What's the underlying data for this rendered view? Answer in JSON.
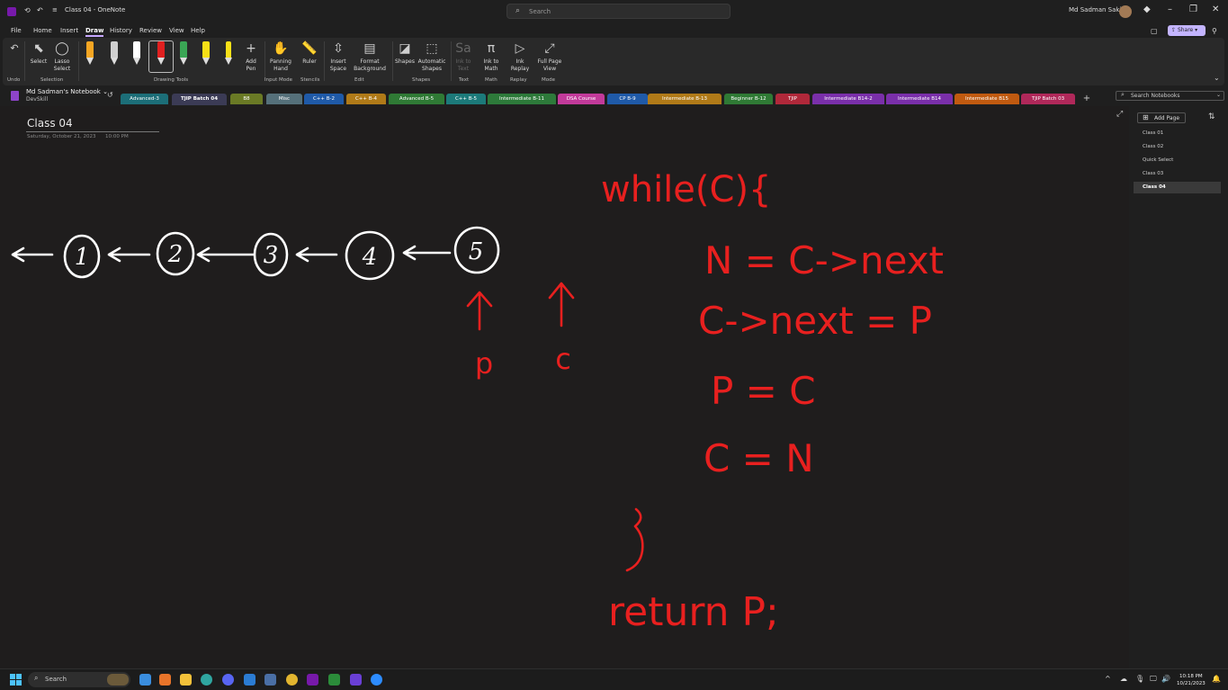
{
  "window": {
    "title": "Class 04 - OneNote",
    "search_placeholder": "Search",
    "user_name": "Md Sadman Sakib",
    "share_label": "Share"
  },
  "menu": [
    "File",
    "Home",
    "Insert",
    "Draw",
    "History",
    "Review",
    "View",
    "Help"
  ],
  "ribbon": {
    "undo": "Undo",
    "select": "Select",
    "lasso": "Lasso Select",
    "add_pen": "Add Pen",
    "panning": "Panning Hand",
    "ruler": "Ruler",
    "insert_space": "Insert Space",
    "format_bg": "Format Background",
    "shapes": "Shapes",
    "auto_shapes": "Automatic Shapes",
    "ink_to_text": "Ink to Text",
    "ink_to_math": "Ink to Math",
    "ink_replay": "Ink Replay",
    "full_page": "Full Page View",
    "groups": {
      "undo": "Undo",
      "selection": "Selection",
      "drawing_tools": "Drawing Tools",
      "input_mode": "Input Mode",
      "stencils": "Stencils",
      "edit": "Edit",
      "shapes": "Shapes",
      "text": "Text",
      "math": "Math",
      "replay": "Replay",
      "mode": "Mode"
    },
    "pen_colors": [
      "#f5a623",
      "#e0e0e0",
      "#ffffff",
      "#e02020",
      "#3aa655",
      "#f7e017",
      "#f7e017"
    ]
  },
  "notebook": {
    "name": "Md Sadman's Notebook",
    "sub": "DevSkill",
    "search_placeholder": "Search Notebooks"
  },
  "sections": [
    {
      "label": "Advanced-3",
      "color": "#1c6e78"
    },
    {
      "label": "TJIP Batch 04",
      "color": "#3b3b55",
      "active": true
    },
    {
      "label": "B8",
      "color": "#6a7a25"
    },
    {
      "label": "Misc",
      "color": "#55707a"
    },
    {
      "label": "C++ B-2",
      "color": "#1f5aa8"
    },
    {
      "label": "C++ B-4",
      "color": "#b07a18"
    },
    {
      "label": "Advanced B-5",
      "color": "#2f7a35"
    },
    {
      "label": "C++ B-5",
      "color": "#1c7a7a"
    },
    {
      "label": "Intermediate B-11",
      "color": "#2d7a3a"
    },
    {
      "label": "DSA Course",
      "color": "#c23a9a"
    },
    {
      "label": "CP B-9",
      "color": "#1f5aa8"
    },
    {
      "label": "Intermediate B-13",
      "color": "#b07a18"
    },
    {
      "label": "Beginner B-12",
      "color": "#2f7a35"
    },
    {
      "label": "TJIP",
      "color": "#b0283a"
    },
    {
      "label": "Intermediate B14-2",
      "color": "#7a2faa"
    },
    {
      "label": "Intermediate B14",
      "color": "#7a2faa"
    },
    {
      "label": "Intermediate B15",
      "color": "#c05a10"
    },
    {
      "label": "TJIP Batch 03",
      "color": "#b0285a"
    }
  ],
  "page": {
    "title": "Class 04",
    "date": "Saturday, October 21, 2023",
    "time": "10:00 PM"
  },
  "pages_pane": {
    "add_page": "Add Page",
    "items": [
      "Class 01",
      "Class 02",
      "Quick Select",
      "Class 03",
      "Class 04"
    ],
    "active_index": 4
  },
  "ink": {
    "color_red": "#e8201f",
    "color_white": "#ffffff",
    "nodes": [
      "1",
      "2",
      "3",
      "4",
      "5"
    ],
    "pointer_labels": [
      "p",
      "c"
    ],
    "code_lines": [
      "while(C){",
      "N = C->next",
      "C->next = P",
      "P = C",
      "C = N",
      "}",
      "return P;"
    ]
  },
  "taskbar": {
    "search": "Search",
    "time": "10:18 PM",
    "date": "10/21/2023"
  }
}
